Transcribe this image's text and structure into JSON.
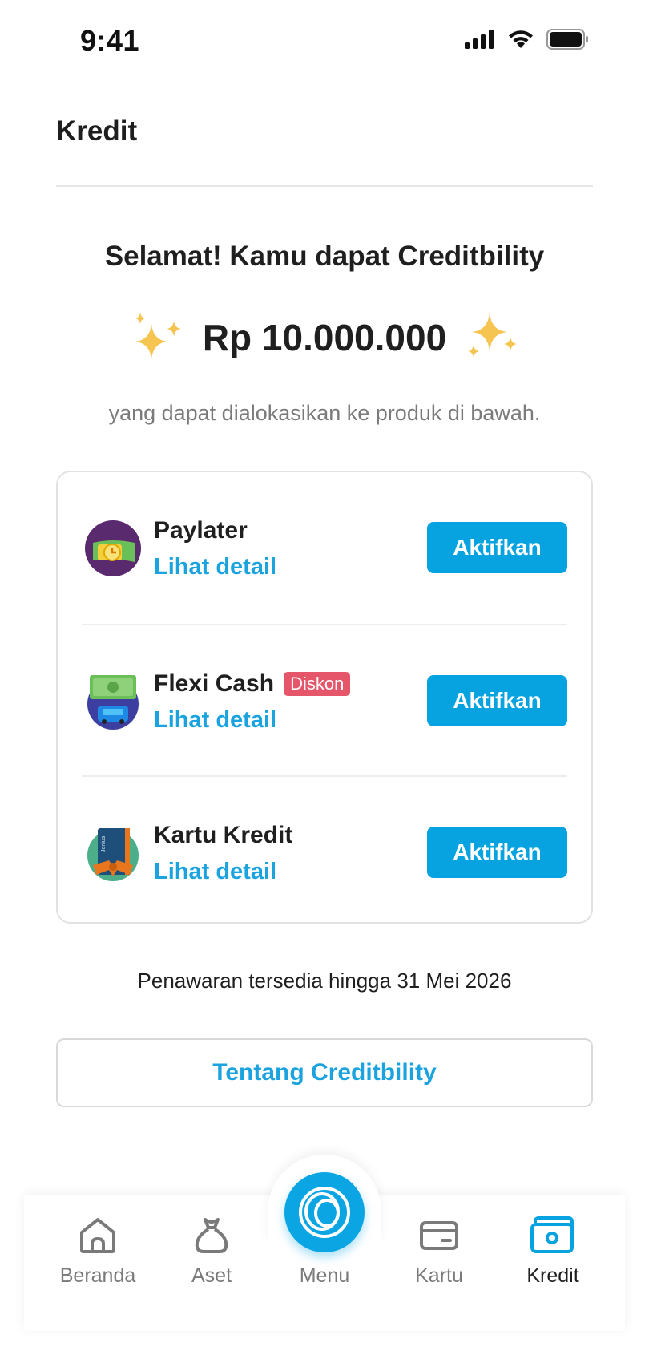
{
  "status_bar": {
    "time": "9:41"
  },
  "header": {
    "title": "Kredit"
  },
  "hero": {
    "title": "Selamat! Kamu dapat Creditbility",
    "amount": "Rp 10.000.000",
    "subtitle": "yang dapat dialokasikan ke produk di bawah."
  },
  "products": [
    {
      "name": "Paylater",
      "badge": "",
      "link": "Lihat detail",
      "button": "Aktifkan",
      "icon": "paylater-icon"
    },
    {
      "name": "Flexi Cash",
      "badge": "Diskon",
      "link": "Lihat detail",
      "button": "Aktifkan",
      "icon": "flexi-cash-icon"
    },
    {
      "name": "Kartu Kredit",
      "badge": "",
      "link": "Lihat detail",
      "button": "Aktifkan",
      "icon": "credit-card-icon",
      "icon_text": "Jenius"
    }
  ],
  "offer_note": "Penawaran tersedia hingga 31 Mei 2026",
  "about_button": "Tentang Creditbility",
  "nav": {
    "items": [
      {
        "label": "Beranda",
        "icon": "home-icon"
      },
      {
        "label": "Aset",
        "icon": "money-bag-icon"
      },
      {
        "label": "Menu",
        "icon": "menu-logo-icon"
      },
      {
        "label": "Kartu",
        "icon": "card-icon"
      },
      {
        "label": "Kredit",
        "icon": "credit-icon",
        "active": true
      }
    ]
  },
  "colors": {
    "accent": "#07a3e0",
    "badge": "#e5566a",
    "sparkle": "#f5c451"
  }
}
